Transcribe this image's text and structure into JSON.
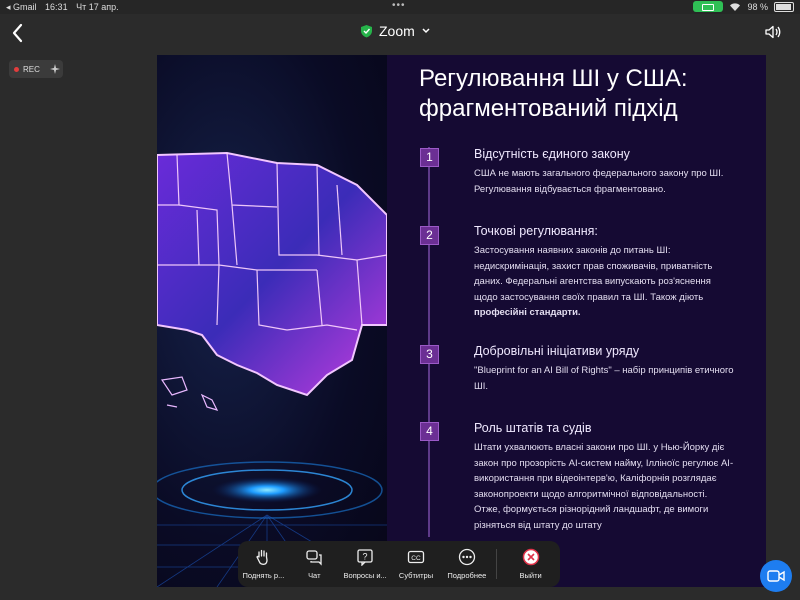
{
  "status_bar": {
    "carrier": "◂ Gmail",
    "time": "16:31",
    "date": "Чт 17 апр.",
    "battery_percent": "98 %",
    "wifi_icon": "wifi-icon",
    "battery_icon": "battery-icon"
  },
  "header": {
    "app_title": "Zoom",
    "shield_icon": "shield-check-icon",
    "chevron_icon": "chevron-down-icon",
    "speaker_icon": "speaker-icon"
  },
  "recording": {
    "label": "REC"
  },
  "slide": {
    "title_line1": "Регулювання ШІ у США:",
    "title_line2": "фрагментований підхід",
    "items": [
      {
        "number": "1",
        "title": "Відсутність єдиного закону",
        "body": "США не мають загального федерального закону про ШІ. Регулювання відбувається фрагментовано."
      },
      {
        "number": "2",
        "title": "Точкові регулювання:",
        "body": "Застосування наявних законів до питань ШІ: недискримінація, захист прав споживачів, приватність даних. Федеральні агентства  випускають роз'яснення щодо застосування своїх правил та ШІ. Також діють",
        "body_bold": "професійні стандарти."
      },
      {
        "number": "3",
        "title": "Добровільні ініціативи уряду",
        "body": "\"Blueprint for an AI Bill of Rights\" – набір принципів етичного ШІ."
      },
      {
        "number": "4",
        "title": "Роль штатів та судів",
        "body": "Штати ухвалюють власні закони про ШІ. у Нью-Йорку діє закон про прозорість AI-систем найму, Ілліноїс регулює AI-використання при відеоінтерв'ю, Каліфорнія розглядає законопроекти щодо алгоритмічної відповідальності. Отже, формується різнорідний ландшафт, де вимоги різняться від штату до штату"
      }
    ]
  },
  "toolbar": {
    "raise_hand": "Поднять р...",
    "chat": "Чат",
    "qa": "Вопросы и...",
    "subtitles": "Субтитры",
    "more": "Подробнее",
    "leave": "Выйти"
  },
  "colors": {
    "accent_purple": "#6b2f94",
    "slide_bg": "#150a33",
    "leave_red": "#e0334a",
    "battery_green": "#2fbf55",
    "camera_blue": "#1e7df0"
  }
}
